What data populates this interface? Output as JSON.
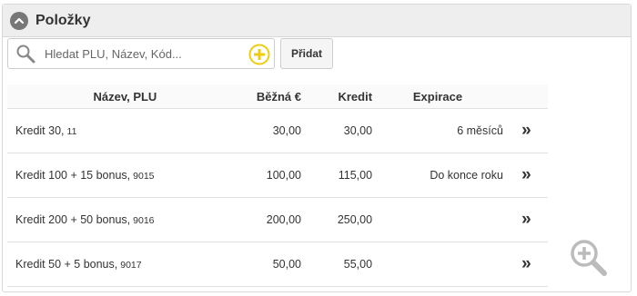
{
  "panel": {
    "title": "Položky"
  },
  "search": {
    "placeholder": "Hledat PLU, Název, Kód...",
    "value": ""
  },
  "toolbar": {
    "add_label": "Přidat"
  },
  "table": {
    "headers": {
      "name": "Název, PLU",
      "price": "Běžná €",
      "credit": "Kredit",
      "expiration": "Expirace"
    },
    "rows": [
      {
        "name": "Kredit 30,",
        "plu": "11",
        "price": "30,00",
        "credit": "30,00",
        "expiration": "6 měsíců",
        "action": "»"
      },
      {
        "name": "Kredit 100 + 15 bonus,",
        "plu": "9015",
        "price": "100,00",
        "credit": "115,00",
        "expiration": "Do konce roku",
        "action": "»"
      },
      {
        "name": "Kredit 200 + 50 bonus,",
        "plu": "9016",
        "price": "200,00",
        "credit": "250,00",
        "expiration": "",
        "action": "»"
      },
      {
        "name": "Kredit 50 + 5 bonus,",
        "plu": "9017",
        "price": "50,00",
        "credit": "55,00",
        "expiration": "",
        "action": "»"
      }
    ]
  },
  "icons": {
    "collapse": "chevron-up-icon",
    "search": "search-icon",
    "add": "plus-circle-icon",
    "zoom": "zoom-in-icon"
  },
  "colors": {
    "accent_yellow": "#f2cc0c",
    "header_bg": "#eeeeee",
    "icon_gray": "#777777"
  }
}
